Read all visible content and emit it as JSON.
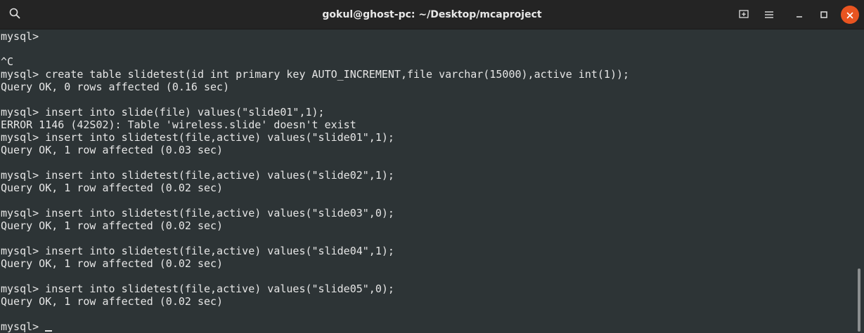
{
  "window": {
    "title": "gokul@ghost-pc: ~/Desktop/mcaproject"
  },
  "icons": {
    "search": "search-icon",
    "new_tab": "new-tab-icon",
    "menu": "hamburger-menu-icon",
    "minimize": "minimize-icon",
    "maximize": "maximize-icon",
    "close": "close-icon"
  },
  "colors": {
    "terminal_bg": "#2d3436",
    "titlebar_bg": "#242424",
    "text": "#e6e6e6",
    "close_button": "#e95420"
  },
  "terminal": {
    "lines": [
      "mysql> ",
      "",
      "^C",
      "mysql> create table slidetest(id int primary key AUTO_INCREMENT,file varchar(15000),active int(1));",
      "Query OK, 0 rows affected (0.16 sec)",
      "",
      "mysql> insert into slide(file) values(\"slide01\",1);",
      "ERROR 1146 (42S02): Table 'wireless.slide' doesn't exist",
      "mysql> insert into slidetest(file,active) values(\"slide01\",1);",
      "Query OK, 1 row affected (0.03 sec)",
      "",
      "mysql> insert into slidetest(file,active) values(\"slide02\",1);",
      "Query OK, 1 row affected (0.02 sec)",
      "",
      "mysql> insert into slidetest(file,active) values(\"slide03\",0);",
      "Query OK, 1 row affected (0.02 sec)",
      "",
      "mysql> insert into slidetest(file,active) values(\"slide04\",1);",
      "Query OK, 1 row affected (0.02 sec)",
      "",
      "mysql> insert into slidetest(file,active) values(\"slide05\",0);",
      "Query OK, 1 row affected (0.02 sec)",
      "",
      "mysql> "
    ]
  }
}
